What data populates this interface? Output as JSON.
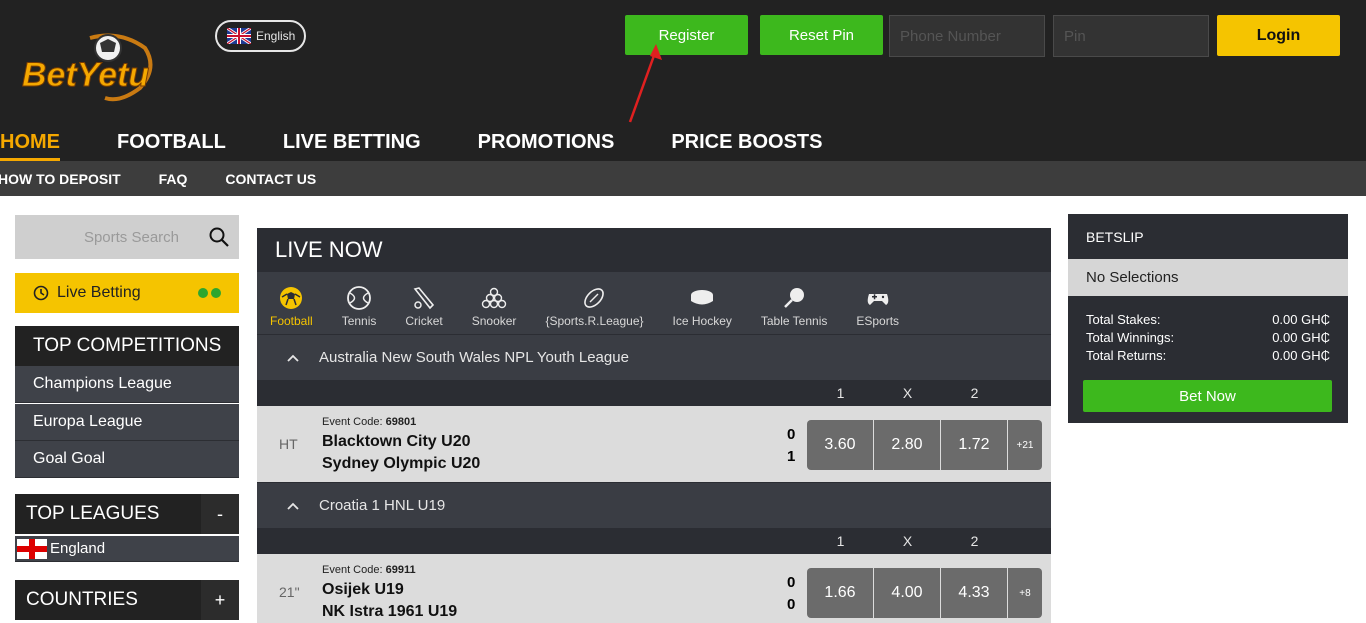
{
  "header": {
    "logo_text": "BetYetu",
    "language": "English",
    "register_label": "Register",
    "reset_pin_label": "Reset Pin",
    "phone_placeholder": "Phone Number",
    "pin_placeholder": "Pin",
    "login_label": "Login"
  },
  "main_nav": [
    "HOME",
    "FOOTBALL",
    "LIVE BETTING",
    "PROMOTIONS",
    "PRICE BOOSTS"
  ],
  "sub_nav": [
    "HOW TO DEPOSIT",
    "FAQ",
    "CONTACT US"
  ],
  "sidebar": {
    "search_placeholder": "Sports Search",
    "live_betting_label": "Live Betting",
    "top_competitions": {
      "title": "TOP COMPETITIONS",
      "items": [
        "Champions League",
        "Europa League",
        "Goal Goal"
      ]
    },
    "top_leagues": {
      "title": "TOP LEAGUES",
      "toggle": "-",
      "items": [
        "England"
      ]
    },
    "countries": {
      "title": "COUNTRIES",
      "toggle": "+"
    }
  },
  "live_now": {
    "title": "LIVE NOW",
    "sports": [
      "Football",
      "Tennis",
      "Cricket",
      "Snooker",
      "{Sports.R.League}",
      "Ice Hockey",
      "Table Tennis",
      "ESports"
    ],
    "columns": [
      "1",
      "X",
      "2"
    ],
    "leagues": [
      {
        "name": "Australia New South Wales NPL Youth League",
        "event": {
          "time": "HT",
          "code_label": "Event Code:",
          "code": "69801",
          "team1": "Blacktown City U20",
          "team2": "Sydney Olympic U20",
          "score1": "0",
          "score2": "1",
          "odds": [
            "3.60",
            "2.80",
            "1.72"
          ],
          "more": "+21"
        }
      },
      {
        "name": "Croatia 1 HNL U19",
        "event": {
          "time": "21\"",
          "code_label": "Event Code:",
          "code": "69911",
          "team1": "Osijek U19",
          "team2": "NK Istra 1961 U19",
          "score1": "0",
          "score2": "0",
          "odds": [
            "1.66",
            "4.00",
            "4.33"
          ],
          "more": "+8"
        }
      }
    ]
  },
  "betslip": {
    "title": "BETSLIP",
    "no_selections": "No Selections",
    "total_stakes_label": "Total Stakes:",
    "total_stakes": "0.00 GH₵",
    "total_winnings_label": "Total Winnings:",
    "total_winnings": "0.00 GH₵",
    "total_returns_label": "Total Returns:",
    "total_returns": "0.00 GH₵",
    "bet_now_label": "Bet Now"
  },
  "colors": {
    "accent_yellow": "#f5c400",
    "accent_green": "#3db81d",
    "nav_active": "#f5a800"
  }
}
